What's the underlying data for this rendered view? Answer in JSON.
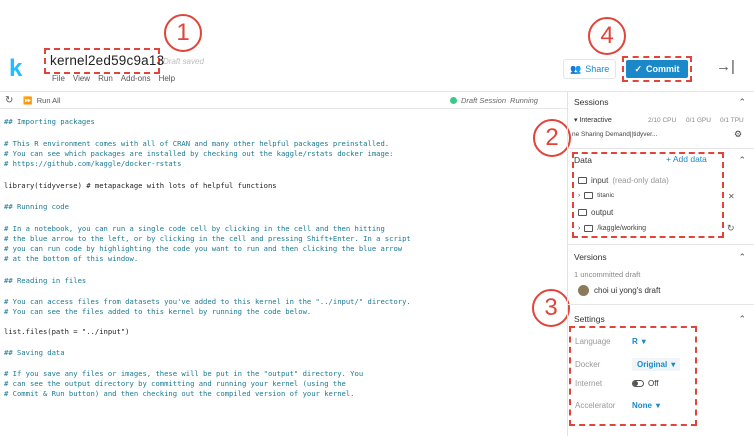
{
  "header": {
    "logo": "k",
    "kernel_title": "kernel2ed59c9a13",
    "draft_status": "Draft saved",
    "menu": [
      "File",
      "View",
      "Run",
      "Add-ons",
      "Help"
    ],
    "share_label": "Share",
    "commit_label": "Commit",
    "collapse_icon": "→|"
  },
  "callouts": [
    "1",
    "2",
    "3",
    "4"
  ],
  "toolbar": {
    "run_all_label": "Run All",
    "session_label": "Draft Session",
    "session_state": "Running"
  },
  "code_lines": [
    {
      "text": "## Importing packages",
      "kind": "comment"
    },
    {
      "text": "# This R environment comes with all of CRAN and many other helpful packages preinstalled.",
      "kind": "comment"
    },
    {
      "text": "# You can see which packages are installed by checking out the kaggle/rstats docker image:",
      "kind": "comment"
    },
    {
      "text": "# https://github.com/kaggle/docker-rstats",
      "kind": "comment"
    },
    {
      "text": "library(tidyverse) # metapackage with lots of helpful functions",
      "kind": "code"
    },
    {
      "text": "## Running code",
      "kind": "comment"
    },
    {
      "text": "# In a notebook, you can run a single code cell by clicking in the cell and then hitting",
      "kind": "comment"
    },
    {
      "text": "# the blue arrow to the left, or by clicking in the cell and pressing Shift+Enter. In a script",
      "kind": "comment"
    },
    {
      "text": "# you can run code by highlighting the code you want to run and then clicking the blue arrow",
      "kind": "comment"
    },
    {
      "text": "# at the bottom of this window.",
      "kind": "comment"
    },
    {
      "text": "## Reading in files",
      "kind": "comment"
    },
    {
      "text": "# You can access files from datasets you've added to this kernel in the \"../input/\" directory.",
      "kind": "comment"
    },
    {
      "text": "# You can see the files added to this kernel by running the code below.",
      "kind": "comment"
    },
    {
      "text": "list.files(path = \"../input\")",
      "kind": "code"
    },
    {
      "text": "## Saving data",
      "kind": "comment"
    },
    {
      "text": "# If you save any files or images, these will be put in the \"output\" directory. You",
      "kind": "comment"
    },
    {
      "text": "# can see the output directory by committing and running your kernel (using the",
      "kind": "comment"
    },
    {
      "text": "# Commit & Run button) and then checking out the compiled version of your kernel.",
      "kind": "comment"
    }
  ],
  "sessions": {
    "title": "Sessions",
    "type": "Interactive",
    "cpu": "2/10 CPU",
    "gpu": "0/1 GPU",
    "tpu": "0/1 TPU",
    "detail": "ne Sharing Demand||tidyver..."
  },
  "data": {
    "title": "Data",
    "add_label": "+ Add data",
    "input_label": "input",
    "input_note": "(read-only data)",
    "titanic_label": "titanic",
    "output_label": "output",
    "working_label": "/kaggle/working"
  },
  "versions": {
    "title": "Versions",
    "uncommitted": "1 uncommitted draft",
    "draft_name": "choi ui yong's draft"
  },
  "settings": {
    "title": "Settings",
    "language_label": "Language",
    "language_value": "R",
    "docker_label": "Docker",
    "docker_value": "Original",
    "internet_label": "Internet",
    "internet_value": "Off",
    "accelerator_label": "Accelerator",
    "accelerator_value": "None"
  },
  "colors": {
    "accent": "#1a88c9",
    "callout": "#e0443a",
    "running": "#3ec78a",
    "comment": "#1a7a92"
  },
  "icons": [
    "refresh-icon",
    "fast-forward-icon",
    "share-icon",
    "check-icon",
    "collapse-panel-icon",
    "folder-icon",
    "chevron-up-icon",
    "gear-icon",
    "close-icon",
    "sync-icon",
    "toggle-icon"
  ]
}
